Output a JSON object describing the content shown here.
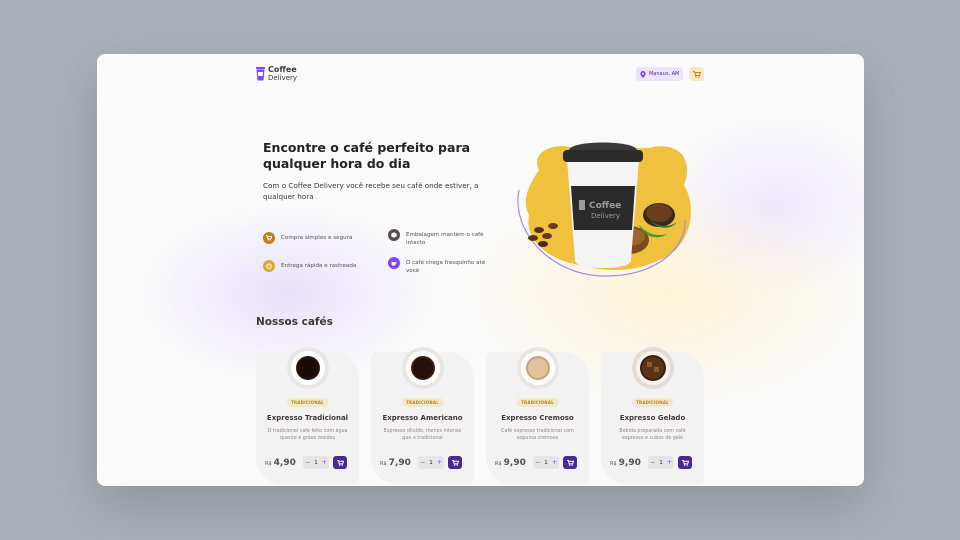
{
  "header": {
    "logo_line1": "Coffee",
    "logo_line2": "Delivery",
    "location": "Manaus, AM",
    "cart_icon": "shopping-cart-icon"
  },
  "hero": {
    "title": "Encontre o café perfeito para qualquer hora do dia",
    "subtitle": "Com o Coffee Delivery você recebe seu café onde estiver, a qualquer hora",
    "features": [
      {
        "label": "Compra simples e segura",
        "icon": "shopping-cart-icon",
        "color": "#c47f17"
      },
      {
        "label": "Embalagem mantém o café intacto",
        "icon": "package-icon",
        "color": "#574f4d"
      },
      {
        "label": "Entrega rápida e rastreada",
        "icon": "timer-icon",
        "color": "#dbac2c"
      },
      {
        "label": "O café chega fresquinho até você",
        "icon": "coffee-icon",
        "color": "#8047f8"
      }
    ]
  },
  "section": {
    "title": "Nossos cafés"
  },
  "coffees": [
    {
      "tag": "TRADICIONAL",
      "name": "Expresso Tradicional",
      "desc": "O tradicional café feito com água quente e grãos moídos",
      "currency": "R$",
      "price": "4,90",
      "qty": "1"
    },
    {
      "tag": "TRADICIONAL",
      "name": "Expresso Americano",
      "desc": "Expresso diluído, menos intenso que o tradicional",
      "currency": "R$",
      "price": "7,90",
      "qty": "1"
    },
    {
      "tag": "TRADICIONAL",
      "name": "Expresso Cremoso",
      "desc": "Café expresso tradicional com espuma cremosa",
      "currency": "R$",
      "price": "9,90",
      "qty": "1"
    },
    {
      "tag": "TRADICIONAL",
      "name": "Expresso Gelado",
      "desc": "Bebida preparada com café expresso e cubos de gelo",
      "currency": "R$",
      "price": "9,90",
      "qty": "1"
    }
  ],
  "qty_minus": "−",
  "qty_plus": "+",
  "colors": {
    "brand_purple": "#8047f8",
    "brand_purple_dark": "#4b2995",
    "brand_yellow": "#dbac2c",
    "brand_yellow_dark": "#c47f17"
  }
}
